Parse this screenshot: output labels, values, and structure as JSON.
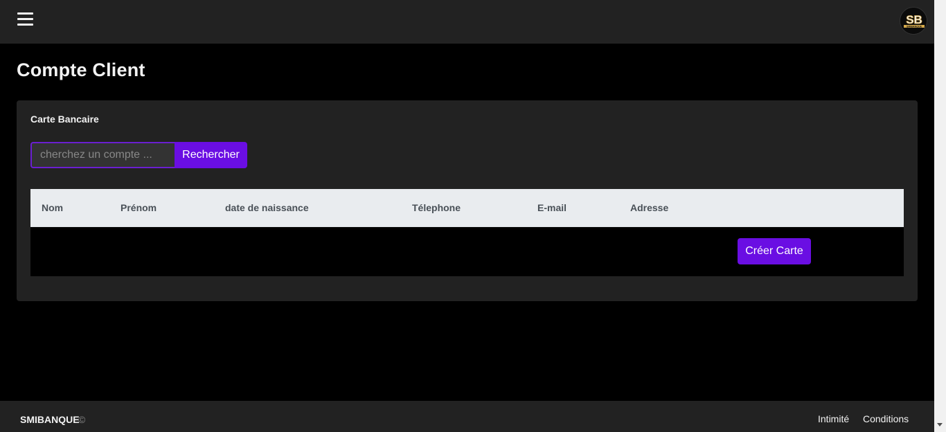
{
  "header": {
    "logo_text": "SB",
    "logo_subtext": "SMIBANQUE"
  },
  "page": {
    "title": "Compte Client"
  },
  "card": {
    "title": "Carte Bancaire",
    "search": {
      "placeholder": "cherchez un compte ...",
      "value": "",
      "button_label": "Rechercher"
    },
    "table": {
      "columns": [
        "Nom",
        "Prénom",
        "date de naissance",
        "Télephone",
        "E-mail",
        "Adresse"
      ],
      "row_action_label": "Créer Carte"
    }
  },
  "footer": {
    "brand": "SMIBANQUE",
    "copyright_symbol": "©",
    "links": [
      "Intimité",
      "Conditions"
    ]
  },
  "colors": {
    "accent": "#6a0ee3",
    "surface": "#222222",
    "background": "#000000",
    "table_header": "#e9ecef"
  }
}
